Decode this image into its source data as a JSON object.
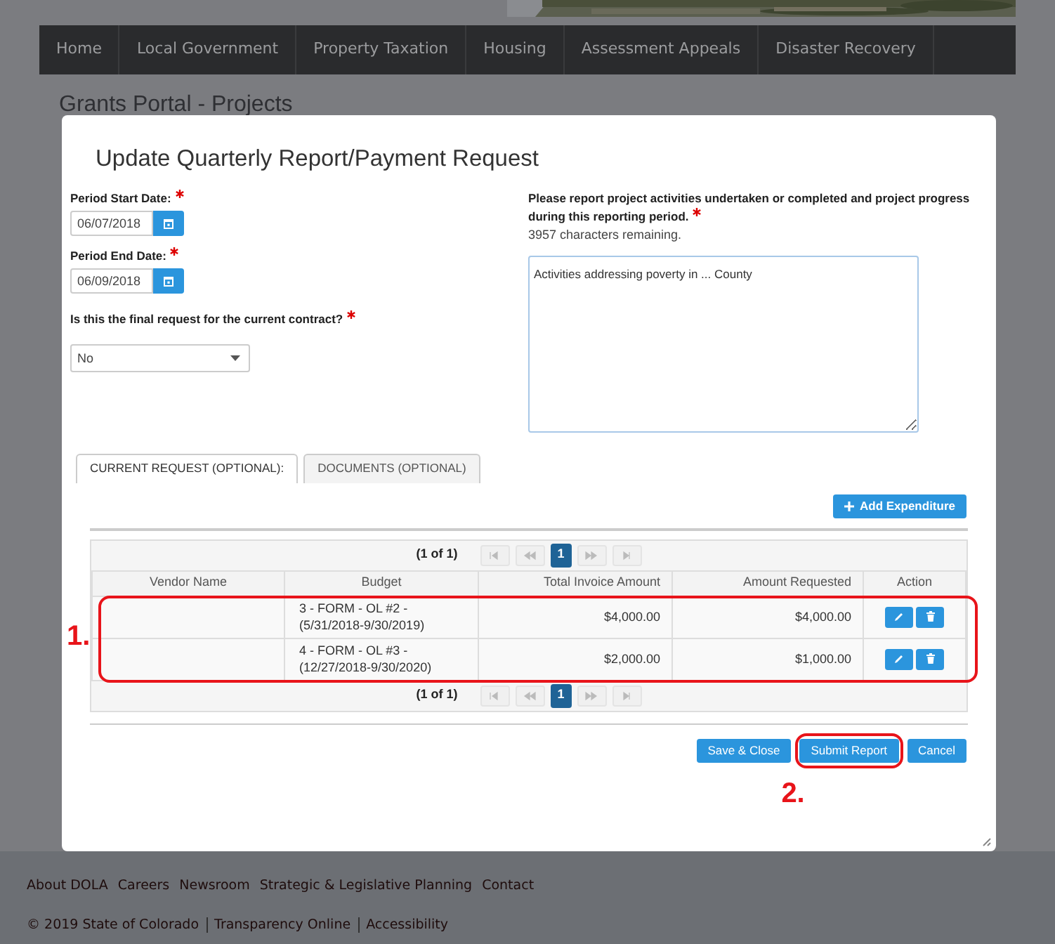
{
  "nav": {
    "items": [
      {
        "label": "Home"
      },
      {
        "label": "Local Government"
      },
      {
        "label": "Property Taxation"
      },
      {
        "label": "Housing"
      },
      {
        "label": "Assessment Appeals"
      },
      {
        "label": "Disaster Recovery"
      }
    ]
  },
  "page_title": "Grants Portal - Projects",
  "modal": {
    "title": "Update Quarterly Report/Payment Request",
    "fields": [
      {
        "kind": "date",
        "label": "Period Start Date:",
        "required": true,
        "value": "06/07/2018"
      },
      {
        "kind": "date",
        "label": "Period End Date:",
        "required": true,
        "value": "06/09/2018"
      },
      {
        "kind": "select",
        "label": "Is this the final request for the current contract?",
        "required": true,
        "value": "No"
      }
    ],
    "description": {
      "label": "Please report project activities undertaken or completed and project progress during this reporting period.",
      "required": true,
      "remaining": "3957 characters remaining.",
      "value": "Activities addressing poverty in ... County"
    },
    "tabs": [
      {
        "label": "CURRENT REQUEST (OPTIONAL):",
        "selected": true
      },
      {
        "label": "DOCUMENTS (OPTIONAL)",
        "selected": false
      }
    ],
    "add_button": "Add Expenditure",
    "pager_top": {
      "summary": "(1 of 1)",
      "pages": [
        {
          "label": "1",
          "selected": true
        }
      ]
    },
    "table": {
      "columns": [
        "Vendor Name",
        "Budget",
        "Total Invoice Amount",
        "Amount Requested",
        "Action"
      ],
      "annotation": "1.",
      "rows": [
        {
          "budget": "3 - FORM - OL #2 - (5/31/2018-9/30/2019)",
          "total": "$4,000.00",
          "requested": "$4,000.00"
        },
        {
          "budget": "4 - FORM - OL #3 - (12/27/2018-9/30/2020)",
          "total": "$2,000.00",
          "requested": "$1,000.00"
        }
      ]
    },
    "pager_bottom": {
      "summary": "(1 of 1)",
      "pages": [
        {
          "label": "1",
          "selected": true
        }
      ]
    },
    "buttons": [
      {
        "label": "Save & Close"
      },
      {
        "label": "Submit Report",
        "annotation": "2."
      },
      {
        "label": "Cancel"
      }
    ]
  },
  "footer": {
    "links": [
      {
        "label": "About DOLA"
      },
      {
        "label": "Careers"
      },
      {
        "label": "Newsroom"
      },
      {
        "label": "Strategic & Legislative Planning"
      },
      {
        "label": "Contact"
      }
    ],
    "copyright": "© 2019 State of Colorado",
    "legal_links": [
      {
        "label": "Transparency Online"
      },
      {
        "label": "Accessibility"
      }
    ]
  }
}
